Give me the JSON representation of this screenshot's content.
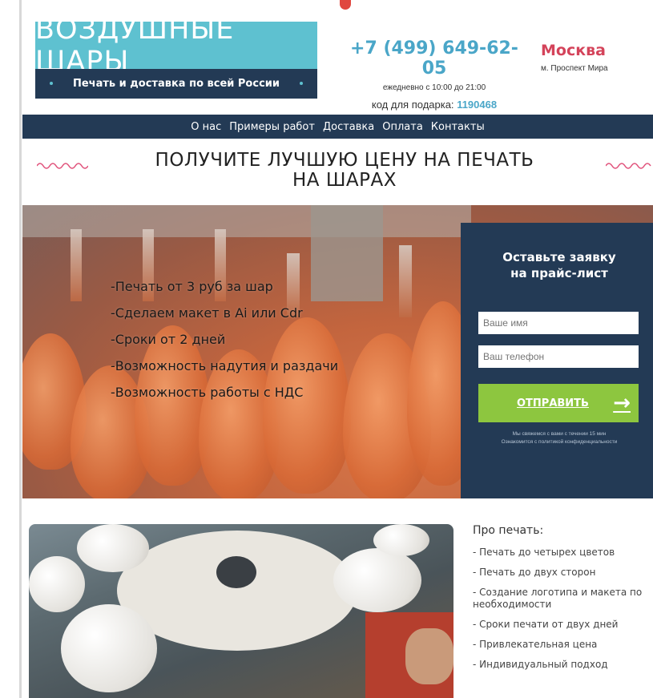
{
  "logo": {
    "title": "ВОЗДУШНЫЕ ШАРЫ",
    "subtitle": "Печать и доставка по всей России"
  },
  "contact": {
    "phone": "+7 (499) 649-62-05",
    "hours": "ежедневно с 10:00 до 21:00",
    "gift_label": "код для подарка:",
    "gift_code": "1190468"
  },
  "city": {
    "name": "Москва",
    "metro": "м. Проспект Мира"
  },
  "nav": {
    "items": [
      "О нас",
      "Примеры работ",
      "Доставка",
      "Оплата",
      "Контакты"
    ]
  },
  "headline": {
    "line1": "ПОЛУЧИТЕ ЛУЧШУЮ ЦЕНУ НА ПЕЧАТЬ",
    "line2": "НА ШАРАХ"
  },
  "hero": {
    "features": [
      "-Печать от 3 руб за шар",
      "-Сделаем макет в Ai или Cdr",
      "-Сроки от 2 дней",
      "-Возможность надутия и раздачи",
      "-Возможность работы с НДС"
    ]
  },
  "form": {
    "title_line1": "Оставьте заявку",
    "title_line2": "на прайс-лист",
    "name_placeholder": "Ваше имя",
    "phone_placeholder": "Ваш телефон",
    "submit_label": "ОТПРАВИТЬ",
    "note1": "Мы свяжемся с вами с течении 15 мин",
    "note2": "Ознакомится с политикой конфиденциальности"
  },
  "about": {
    "title": "Про печать:",
    "items": [
      "- Печать до четырех цветов",
      "- Печать до двух сторон",
      "- Создание логотипа и макета по необходимости",
      "- Сроки печати от двух дней",
      "- Привлекательная цена",
      "- Индивидуальный подход"
    ]
  },
  "colors": {
    "accent": "#5ec1d0",
    "navy": "#233a55",
    "city": "#d4435a",
    "button": "#8dc63f",
    "phone": "#4aa6c8"
  }
}
